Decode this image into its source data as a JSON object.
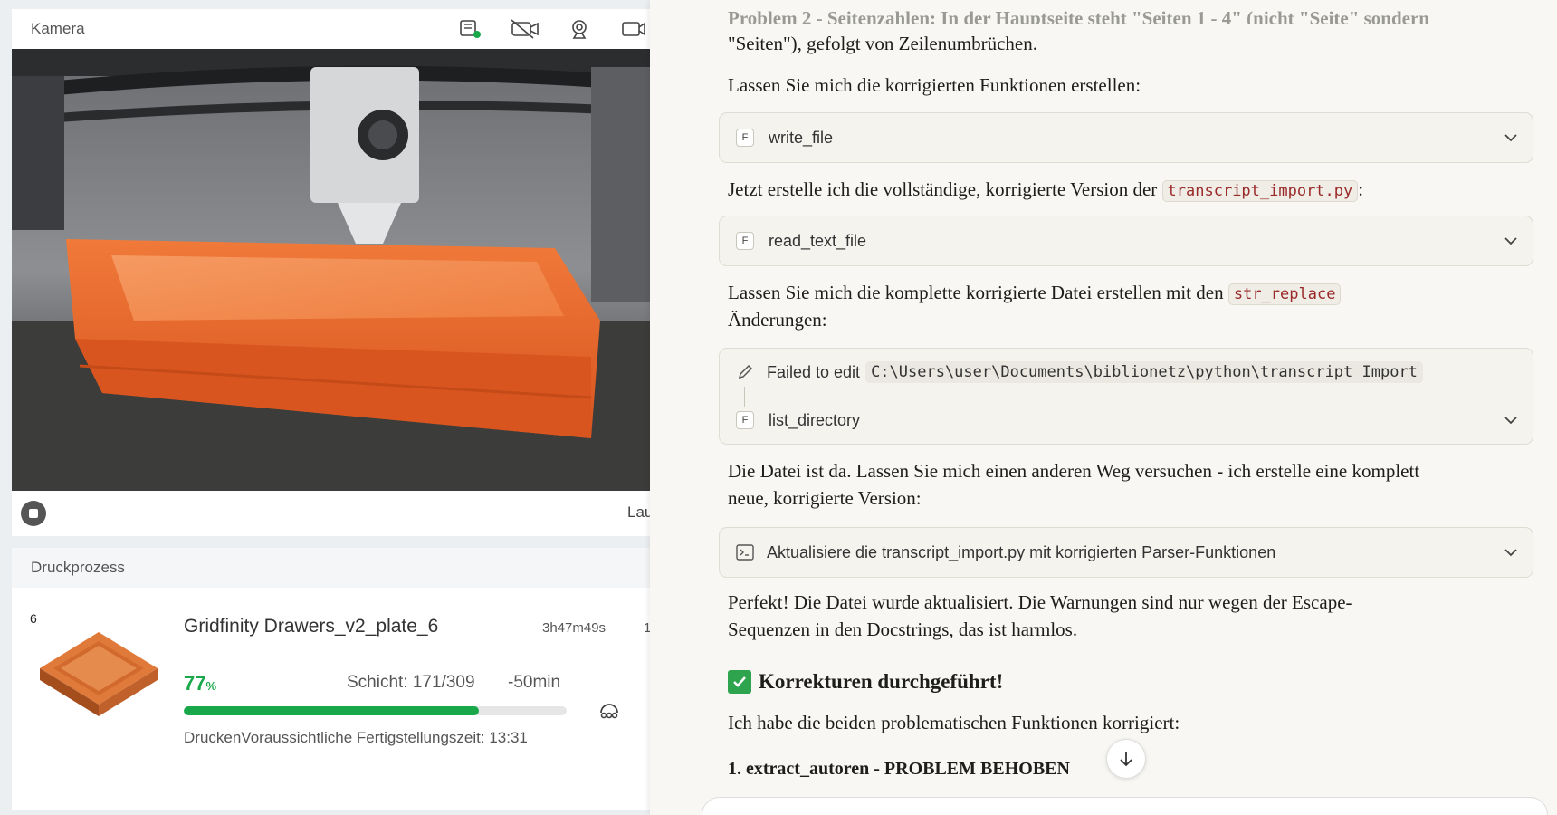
{
  "camera": {
    "title": "Kamera",
    "toolbar": [
      "sd-card-icon",
      "camera-off-icon",
      "webcam-icon",
      "video-icon"
    ],
    "footer_trail": "Lau"
  },
  "print": {
    "title": "Druckprozess",
    "plate": "6",
    "job_name": "Gridfinity Drawers_v2_plate_6",
    "elapsed": "3h47m49s",
    "trail": "1",
    "percent_value": "77",
    "percent_unit": "%",
    "progress": 0.77,
    "layer": "Schicht: 171/309",
    "remaining": "-50min",
    "status": "DruckenVoraussichtliche Fertigstellungszeit: 13:31",
    "accent": "#18a84a"
  },
  "chat": {
    "faded_top": "Problem 2 - Seitenzahlen: In der Hauptseite steht \"Seiten 1 - 4\" (nicht \"Seite\" sondern",
    "p1": "\"Seiten\"), gefolgt von Zeilenumbrüchen.",
    "p2": "Lassen Sie mich die korrigierten Funktionen erstellen:",
    "tool_write": "write_file",
    "p3_before": "Jetzt erstelle ich die vollständige, korrigierte Version der ",
    "p3_code": "transcript_import.py",
    "p3_after": ":",
    "tool_read": "read_text_file",
    "p4_before": "Lassen Sie mich die komplette korrigierte Datei erstellen mit den ",
    "p4_code": "str_replace",
    "p4_line2": "Änderungen:",
    "failed_label": "Failed to edit",
    "failed_path": "C:\\Users\\user\\Documents\\biblionetz\\python\\transcript Import",
    "tool_list": "list_directory",
    "p5_line1": "Die Datei ist da. Lassen Sie mich einen anderen Weg versuchen - ich erstelle eine komplett",
    "p5_line2": "neue, korrigierte Version:",
    "tool_cmd": "Aktualisiere die transcript_import.py mit korrigierten Parser-Funktionen",
    "p6_line1": "Perfekt! Die Datei wurde aktualisiert. Die Warnungen sind nur wegen der Escape-",
    "p6_line2": "Sequenzen in den Docstrings, das ist harmlos.",
    "heading": "Korrekturen durchgeführt!",
    "p7": "Ich habe die beiden problematischen Funktionen korrigiert:",
    "subheading": "1. extract_autoren - PROBLEM BEHOBEN"
  }
}
